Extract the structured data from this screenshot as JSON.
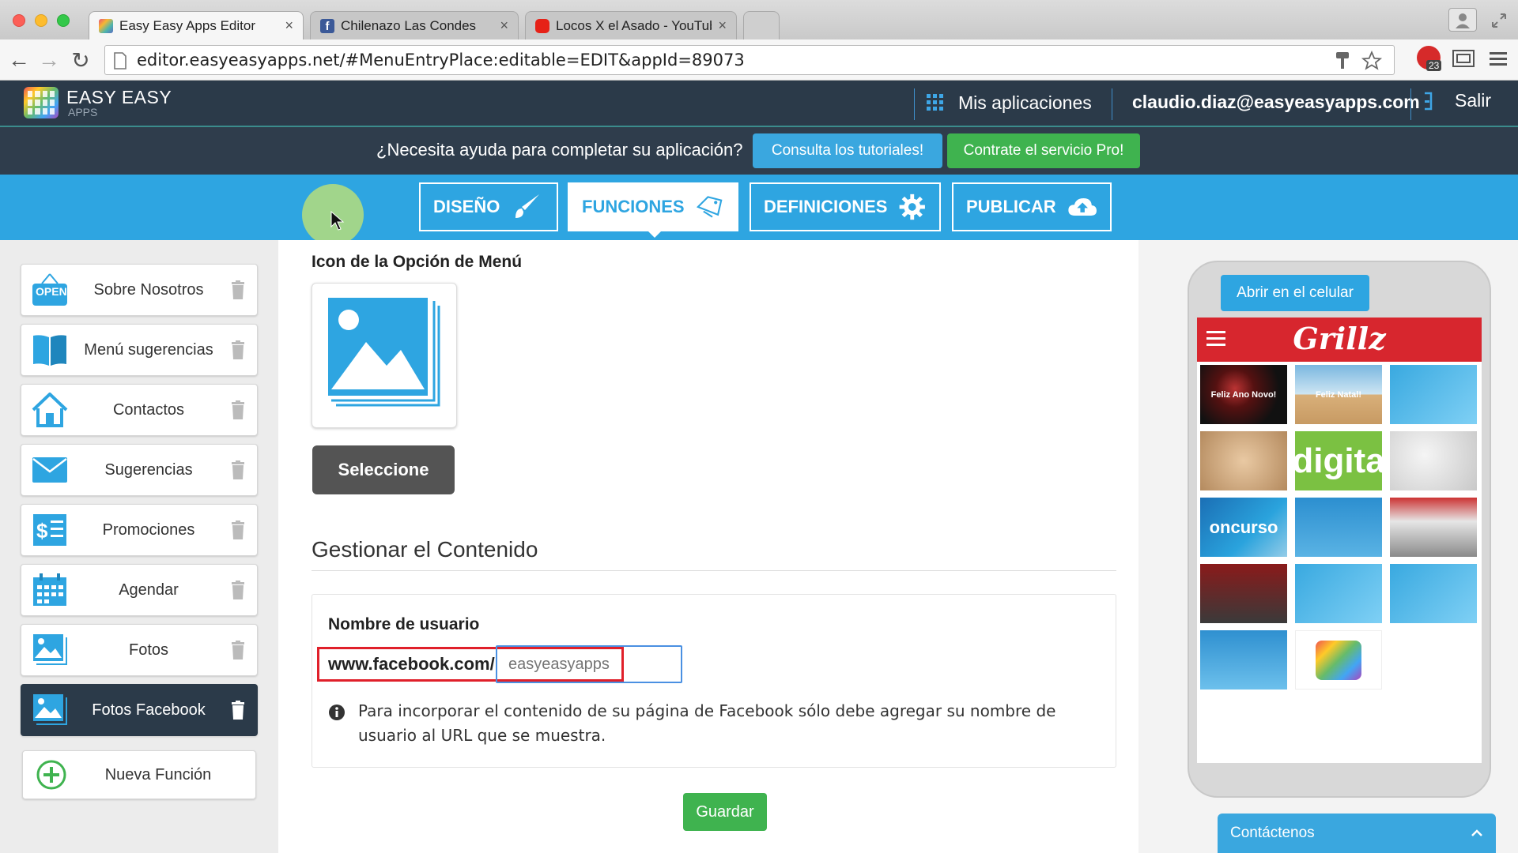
{
  "browser": {
    "tabs": [
      {
        "title": "Easy Easy Apps Editor",
        "close": "×"
      },
      {
        "title": "Chilenazo Las Condes",
        "close": "×"
      },
      {
        "title": "Locos X el Asado - YouTube",
        "close": "×"
      }
    ],
    "url": "editor.easyeasyapps.net/#MenuEntryPlace:editable=EDIT&appId=89073",
    "extension_badge": "23"
  },
  "header": {
    "logo_line1": "EASY EASY",
    "logo_line2": "APPS",
    "my_apps": "Mis aplicaciones",
    "user_email": "claudio.diaz@easyeasyapps.com",
    "logout": "Salir"
  },
  "helpbar": {
    "question": "¿Necesita ayuda para completar su aplicación?",
    "tutorials_button": "Consulta los tutoriales!",
    "pro_button": "Contrate el servicio Pro!"
  },
  "navtabs": [
    "DISEÑO",
    "FUNCIONES",
    "DEFINICIONES",
    "PUBLICAR"
  ],
  "sidebar": {
    "items": [
      {
        "label": "Sobre Nosotros",
        "icon": "open-sign-icon"
      },
      {
        "label": "Menú sugerencias",
        "icon": "book-icon"
      },
      {
        "label": "Contactos",
        "icon": "house-icon"
      },
      {
        "label": "Sugerencias",
        "icon": "envelope-icon"
      },
      {
        "label": "Promociones",
        "icon": "promotion-icon"
      },
      {
        "label": "Agendar",
        "icon": "calendar-icon"
      },
      {
        "label": "Fotos",
        "icon": "photos-icon"
      },
      {
        "label": "Fotos Facebook",
        "icon": "photos-icon"
      }
    ],
    "new_function": "Nueva Función",
    "open_badge": "OPEN"
  },
  "main": {
    "icon_title": "Icon de la Opción de Menú",
    "select_button": "Seleccione",
    "manage_title": "Gestionar el Contenido",
    "username_label": "Nombre de usuario",
    "url_prefix": "www.facebook.com/",
    "username_placeholder": "easyeasyapps",
    "username_value": "",
    "info_text": "Para incorporar el contenido de su página de Facebook sólo debe agregar su nombre de usuario al URL que se muestra.",
    "save_button": "Guardar"
  },
  "preview": {
    "open_mobile_button": "Abrir en el celular",
    "app_name": "Grillz",
    "thumb_texts": [
      "Feliz Ano Novo!",
      "Feliz Natal!",
      "",
      "",
      "digita",
      "",
      "oncurso",
      "",
      "",
      "",
      "",
      "",
      "",
      ""
    ]
  },
  "contact_widget": {
    "label": "Contáctenos"
  },
  "colors": {
    "header_dark": "#2b3a49",
    "nav_blue": "#2ea5e1",
    "green": "#3fb34f",
    "red_highlight": "#e0202a",
    "app_red": "#d7262e"
  }
}
